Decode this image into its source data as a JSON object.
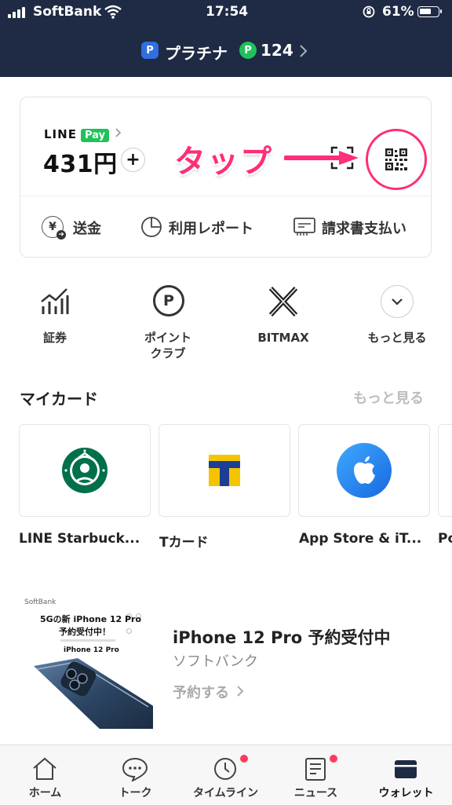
{
  "status_bar": {
    "carrier": "SoftBank",
    "time": "17:54",
    "battery": "61%"
  },
  "header": {
    "rank_label": "プラチナ",
    "rank_badge": "P",
    "points_badge": "P",
    "points": "124"
  },
  "pay_card": {
    "brand_line": "LINE",
    "brand_pay": "Pay",
    "amount": "431円",
    "add_symbol": "+",
    "actions": [
      {
        "label": "送金",
        "icon": "yen-send-icon"
      },
      {
        "label": "利用レポート",
        "icon": "pie-chart-icon"
      },
      {
        "label": "請求書支払い",
        "icon": "invoice-icon"
      }
    ]
  },
  "annotation": {
    "text": "タップ",
    "color": "#ff2d7a"
  },
  "menu": [
    {
      "label": "証券",
      "icon": "chart-bars-icon"
    },
    {
      "label": "ポイント\nクラブ",
      "icon": "point-p-icon"
    },
    {
      "label": "BITMAX",
      "icon": "bitmax-x-icon"
    },
    {
      "label": "もっと見る",
      "icon": "chevron-down-icon"
    }
  ],
  "my_cards": {
    "title": "マイカード",
    "more": "もっと見る",
    "items": [
      {
        "label": "LINE Starbuck...",
        "icon": "starbucks-logo-icon"
      },
      {
        "label": "Tカード",
        "icon": "t-card-logo-icon"
      },
      {
        "label": "App Store & iT...",
        "icon": "apple-logo-icon"
      },
      {
        "label": "Po",
        "icon": ""
      }
    ]
  },
  "ad": {
    "thumb_brand": "SoftBank",
    "thumb_line1": "5Gの新 iPhone 12 Pro",
    "thumb_line2": "予約受付中！",
    "thumb_product": "iPhone 12 Pro",
    "title": "iPhone 12 Pro 予約受付中",
    "advertiser": "ソフトバンク",
    "cta": "予約する"
  },
  "tabs": [
    {
      "label": "ホーム",
      "icon": "home-icon",
      "badge": false
    },
    {
      "label": "トーク",
      "icon": "chat-icon",
      "badge": false
    },
    {
      "label": "タイムライン",
      "icon": "clock-icon",
      "badge": true
    },
    {
      "label": "ニュース",
      "icon": "news-icon",
      "badge": true
    },
    {
      "label": "ウォレット",
      "icon": "wallet-icon",
      "badge": false,
      "active": true
    }
  ],
  "colors": {
    "header_bg": "#1f2a44",
    "line_green": "#1fc15b",
    "annotation_pink": "#ff2d7a",
    "badge_red": "#ff3b5c"
  }
}
